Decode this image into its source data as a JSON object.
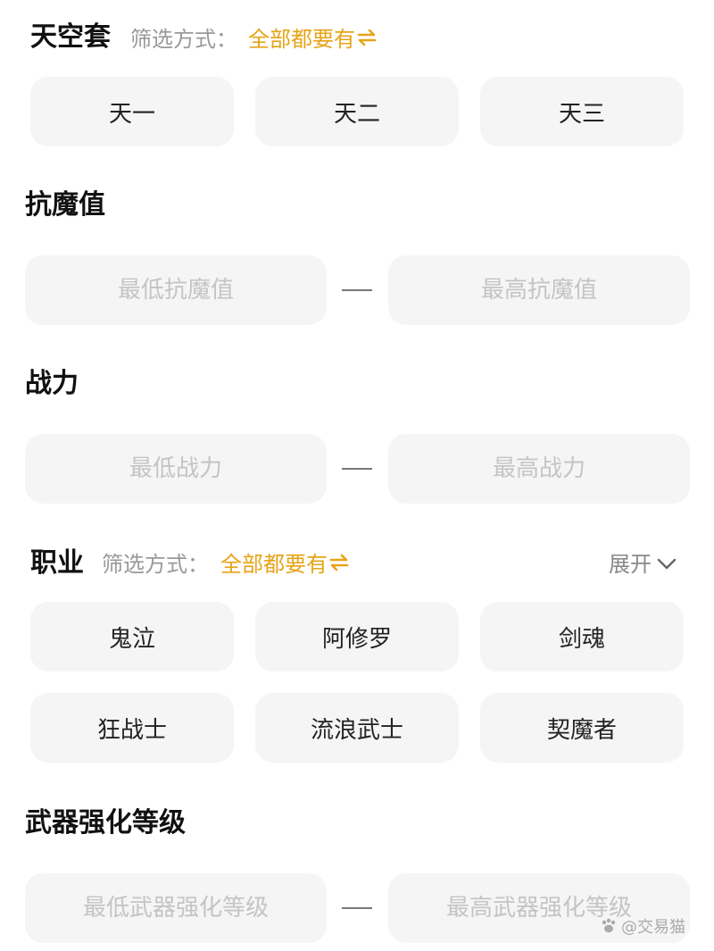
{
  "tiankong": {
    "title": "天空套",
    "filter_label": "筛选方式：",
    "filter_value": "全部都要有",
    "filter_icon": "swap-icon",
    "options": [
      "天一",
      "天二",
      "天三"
    ]
  },
  "kangmo": {
    "title": "抗魔值",
    "min_placeholder": "最低抗魔值",
    "max_placeholder": "最高抗魔值"
  },
  "zhanli": {
    "title": "战力",
    "min_placeholder": "最低战力",
    "max_placeholder": "最高战力"
  },
  "zhiye": {
    "title": "职业",
    "filter_label": "筛选方式：",
    "filter_value": "全部都要有",
    "filter_icon": "swap-icon",
    "expand_label": "展开",
    "expand_icon": "chevron-down-icon",
    "options": [
      "鬼泣",
      "阿修罗",
      "剑魂",
      "狂战士",
      "流浪武士",
      "契魔者"
    ]
  },
  "weapon": {
    "title": "武器强化等级",
    "min_placeholder": "最低武器强化等级",
    "max_placeholder": "最高武器强化等级"
  },
  "watermark": {
    "text": "@交易猫",
    "icon": "paw-icon"
  },
  "colors": {
    "accent": "#e6a417",
    "chip_bg": "#f5f5f5",
    "placeholder": "#c4c4c4",
    "muted": "#999999"
  }
}
